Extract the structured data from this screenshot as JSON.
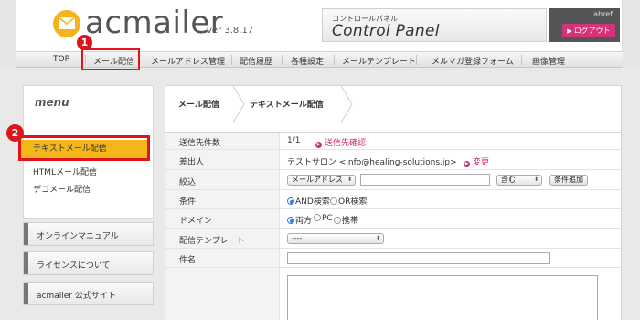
{
  "header": {
    "app_name": "acmailer",
    "version": "ver 3.8.17",
    "panel_small": "コントロールパネル",
    "panel_large": "Control Panel",
    "username": "ahref",
    "logout_label": "ログアウト"
  },
  "nav": {
    "items": [
      "TOP",
      "メール配信",
      "メールアドレス管理",
      "配信履歴",
      "各種設定",
      "メールテンプレート",
      "メルマガ登録フォーム",
      "画像管理"
    ]
  },
  "annotations": {
    "badge1": "1",
    "badge2": "2"
  },
  "sidebar": {
    "menu_title": "menu",
    "items": [
      "テキストメール配信",
      "HTMLメール配信",
      "デコメール配信"
    ],
    "active_index": 0,
    "links": [
      "オンラインマニュアル",
      "ライセンスについて",
      "acmailer 公式サイト"
    ]
  },
  "breadcrumb": [
    "メール配信",
    "テキストメール配信"
  ],
  "form": {
    "recipients_label": "送信先件数",
    "recipients_value": "1/1",
    "recipients_link": "送信先確認",
    "sender_label": "差出人",
    "sender_value": "テストサロン <info@healing-solutions.jp>",
    "sender_link": "変更",
    "filter_label": "絞込",
    "filter_field": "メールアドレス",
    "filter_match": "含む",
    "filter_add": "条件追加",
    "condition_label": "条件",
    "condition_options": [
      "AND検索",
      "OR検索"
    ],
    "condition_selected": 0,
    "domain_label": "ドメイン",
    "domain_options": [
      "両方",
      "PC",
      "携帯"
    ],
    "domain_selected": 0,
    "template_label": "配信テンプレート",
    "template_value": "----",
    "subject_label": "件名",
    "subject_value": ""
  },
  "colors": {
    "brand_yellow": "#f5b419",
    "active_menu": "#f3b719",
    "accent_pink": "#cc2d73",
    "highlight_red": "#e0141b"
  }
}
